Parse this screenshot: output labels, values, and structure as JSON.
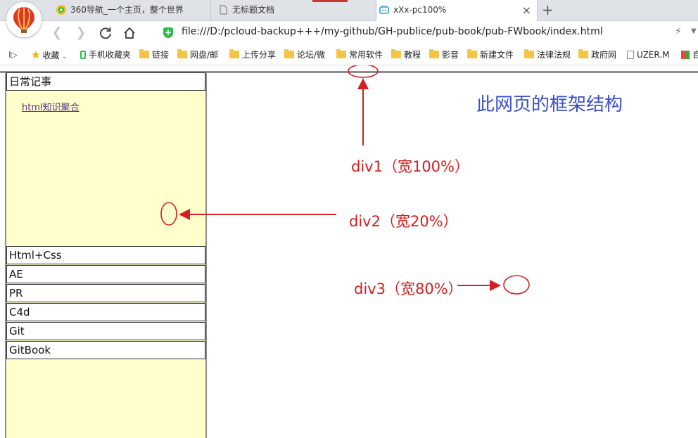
{
  "browser": {
    "tabs": [
      {
        "label": "360导航_一个主页，整个世界"
      },
      {
        "label": "无标题文档"
      },
      {
        "label": "xXx-pc100%",
        "close": "×"
      }
    ],
    "new_tab": "+",
    "url": "file:///D:/pcloud-backup+++/my-github/GH-publice/pub-book/pub-FWbook/index.html",
    "bookmarks_toggle": "I▷",
    "bookmarks": [
      {
        "label": "收藏",
        "icon": "star-icon"
      },
      {
        "label": "手机收藏夹",
        "icon": "phone-icon"
      },
      {
        "label": "链接",
        "icon": "folder-icon"
      },
      {
        "label": "网盘/邮",
        "icon": "folder-icon"
      },
      {
        "label": "上传分享",
        "icon": "folder-icon"
      },
      {
        "label": "论坛/微",
        "icon": "folder-icon"
      },
      {
        "label": "常用软件",
        "icon": "folder-icon"
      },
      {
        "label": "教程",
        "icon": "folder-icon"
      },
      {
        "label": "影音",
        "icon": "folder-icon"
      },
      {
        "label": "新建文件",
        "icon": "folder-icon"
      },
      {
        "label": "法律法规",
        "icon": "folder-icon"
      },
      {
        "label": "政府网",
        "icon": "folder-icon"
      },
      {
        "label": "UZER.M",
        "icon": "doc-icon"
      },
      {
        "label": "自",
        "icon": "tiles-icon"
      }
    ]
  },
  "page": {
    "menu": [
      {
        "label": "日常记事"
      },
      {
        "label": "Html+Css"
      },
      {
        "label": "AE"
      },
      {
        "label": "PR"
      },
      {
        "label": "C4d"
      },
      {
        "label": "Git"
      },
      {
        "label": "GitBook"
      }
    ],
    "sublink": "html知识聚合",
    "note_title": "此网页的框架结构",
    "annotations": {
      "div1": "div1（宽100%）",
      "div2": "div2（宽20%）",
      "div3": "div3（宽80%）"
    },
    "colors": {
      "annotation": "#d32020",
      "note_title": "#3b4ec8",
      "sidebar_bg": "#ffffcc"
    }
  }
}
